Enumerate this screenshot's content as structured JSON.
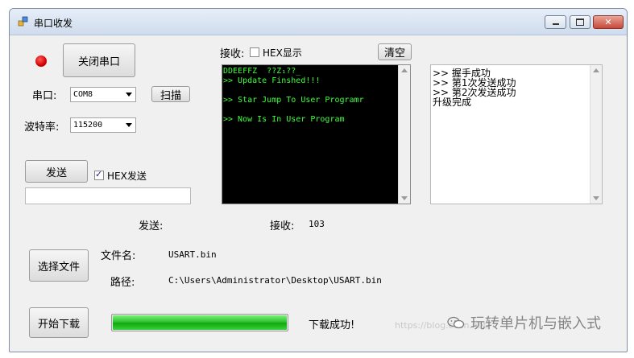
{
  "window": {
    "title": "串口收发"
  },
  "serial": {
    "close_port_label": "关闭串口",
    "port_label": "串口:",
    "port_value": "COM8",
    "scan_label": "扫描",
    "baud_label": "波特率:",
    "baud_value": "115200"
  },
  "send": {
    "send_label": "发送",
    "hex_send_label": "HEX发送",
    "hex_send_checked": true,
    "input_value": ""
  },
  "receive": {
    "label": "接收:",
    "hex_display_label": "HEX显示",
    "hex_display_checked": false,
    "clear_label": "清空",
    "console_lines": [
      "DDEEFFZ  ??Z₁??_",
      ">> Update Finshed!!!",
      "",
      ">> Star Jump To User Programr",
      "",
      ">> Now Is In User Program"
    ]
  },
  "log": {
    "lines": [
      ">> 握手成功",
      ">> 第1次发送成功",
      ">> 第2次发送成功",
      "升级完成"
    ]
  },
  "counters": {
    "sent_label": "发送:",
    "sent_value": "",
    "received_label": "接收:",
    "received_value": "103"
  },
  "file": {
    "select_label": "选择文件",
    "name_label": "文件名:",
    "name_value": "USART.bin",
    "path_label": "路径:",
    "path_value": "C:\\Users\\Administrator\\Desktop\\USART.bin"
  },
  "download": {
    "start_label": "开始下载",
    "progress_fraction": 1.0,
    "status_text": "下载成功!"
  },
  "watermark": {
    "text": "玩转单片机与嵌入式",
    "url": "https://blog.csdn.net/"
  },
  "colors": {
    "console_bg": "#000000",
    "console_text": "#3aff3a",
    "progress": "#2fc22f",
    "led": "#d40000"
  }
}
